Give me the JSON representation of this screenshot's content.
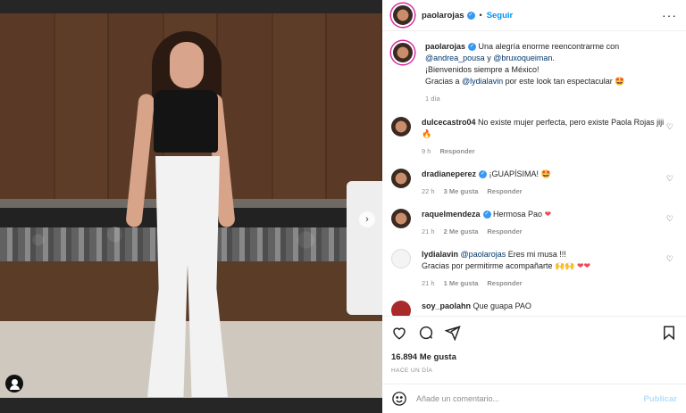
{
  "header": {
    "username": "paolarojas",
    "separator": "•",
    "follow_label": "Seguir",
    "more_label": "···"
  },
  "caption": {
    "username": "paolarojas",
    "text_1": " Una alegría enorme reencontrarme con",
    "mention_1": "@andrea_pousa",
    "text_2": " y ",
    "mention_2": "@bruxoqueiman",
    "text_3": ".",
    "line_2": "¡Bienvenidos siempre a México!",
    "text_4": "Gracias a ",
    "mention_3": "@lydialavin",
    "text_5": " por este look tan espectacular 🤩",
    "time": "1 día"
  },
  "comments": [
    {
      "username": "dulcecastro04",
      "text": " No existe mujer perfecta, pero existe Paola Rojas jiji🔥",
      "time": "9 h",
      "likes": "",
      "reply": "Responder"
    },
    {
      "username": "dradianeperez",
      "text": " ¡GUAPÍSIMA! 🤩",
      "time": "22 h",
      "likes": "3 Me gusta",
      "reply": "Responder"
    },
    {
      "username": "raquelmendeza",
      "text": " Hermosa Pao ",
      "heart": "❤",
      "time": "21 h",
      "likes": "2 Me gusta",
      "reply": "Responder"
    },
    {
      "username": "lydialavin",
      "mention": "@paolarojas",
      "text": " Eres mi musa !!!",
      "line_2": "Gracias por permitirme acompañarte 🙌🙌",
      "hearts": "❤❤",
      "time": "21 h",
      "likes": "1 Me gusta",
      "reply": "Responder"
    },
    {
      "username": "soy_paolahn",
      "text": " Que guapa PAO"
    }
  ],
  "post": {
    "likes": "16.894 Me gusta",
    "time_ago": "HACE UN DÍA"
  },
  "composer": {
    "placeholder": "Añade un comentario...",
    "publish_label": "Publicar"
  },
  "next_arrow": "›"
}
